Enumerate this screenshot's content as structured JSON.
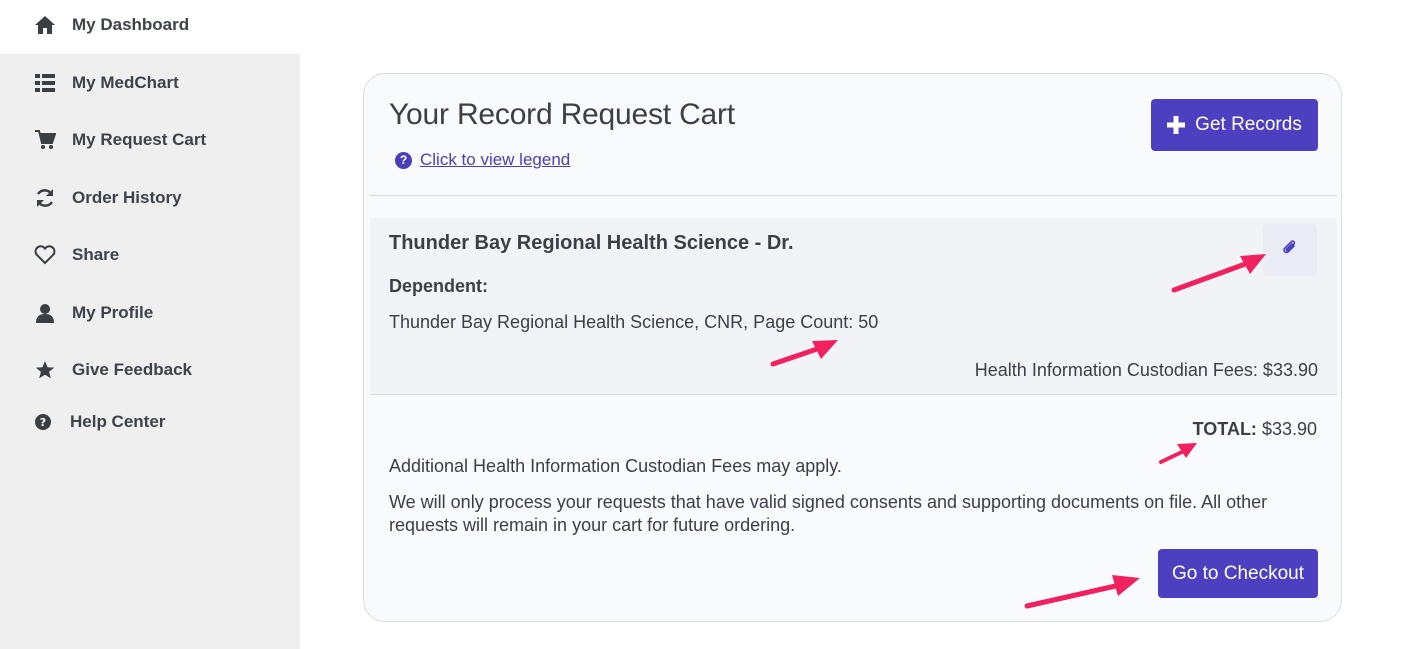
{
  "sidebar": {
    "items": [
      {
        "label": "My Dashboard",
        "icon": "home-icon"
      },
      {
        "label": "My MedChart",
        "icon": "list-icon"
      },
      {
        "label": "My Request Cart",
        "icon": "cart-icon"
      },
      {
        "label": "Order History",
        "icon": "refresh-icon"
      },
      {
        "label": "Share",
        "icon": "heart-icon"
      },
      {
        "label": "My Profile",
        "icon": "user-icon"
      },
      {
        "label": "Give Feedback",
        "icon": "star-icon"
      },
      {
        "label": "Help Center",
        "icon": "question-circle-icon"
      }
    ]
  },
  "cart": {
    "title": "Your Record Request Cart",
    "legend_link": " Click to view legend",
    "legend_icon": "?",
    "get_records_label": "Get Records",
    "item": {
      "title": "Thunder Bay Regional Health Science - Dr.",
      "dependent_label": "Dependent:",
      "detail": "Thunder Bay Regional Health Science, CNR, Page Count: 50",
      "fees": "Health Information Custodian Fees: $33.90",
      "attach_icon": "paperclip-icon"
    },
    "total_label": "TOTAL:",
    "total_value": " $33.90",
    "note1": "Additional Health Information Custodian Fees may apply.",
    "note2": "We will only process your requests that have valid signed consents and supporting documents on file. All other requests will remain in your cart for future ordering.",
    "checkout_label": "Go to Checkout"
  },
  "colors": {
    "accent": "#4c3fc0",
    "sidebar_bg": "#efeff0",
    "annotation_arrow": "#f0215e"
  }
}
